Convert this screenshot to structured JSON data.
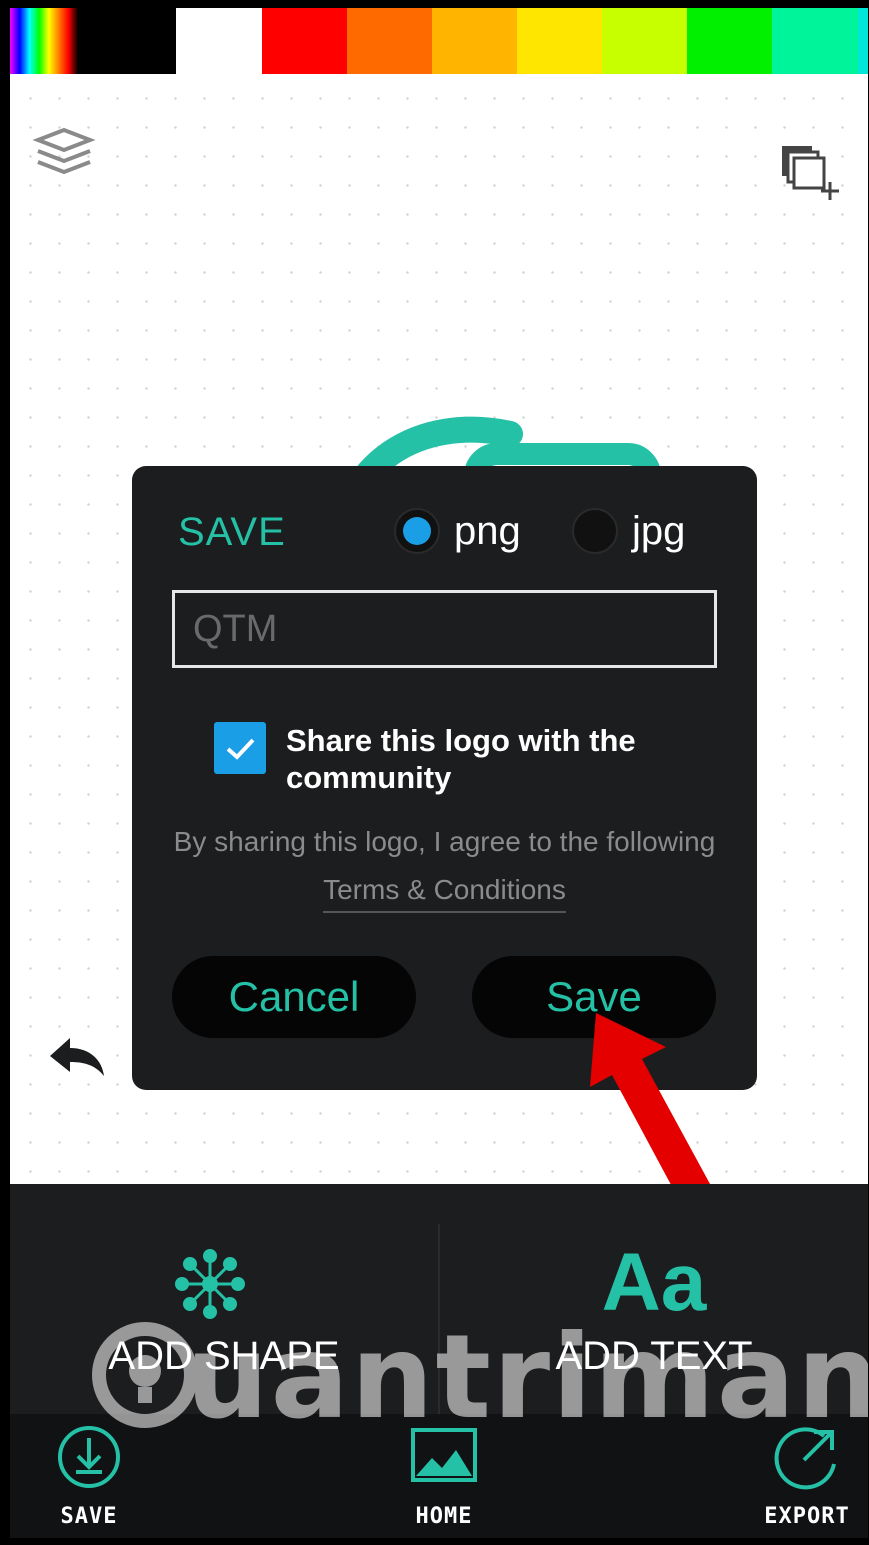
{
  "colors": {
    "accent": "#25c1a7",
    "selection_blue": "#1a9ee6",
    "dialog_bg": "#1c1d1f",
    "annotation_red": "#e50000",
    "palette": [
      "#000000",
      "#ffffff",
      "#ff0000",
      "#ff6a00",
      "#ffb400",
      "#ffe600",
      "#c8ff00",
      "#00f000",
      "#00f59a",
      "#00e6d8"
    ]
  },
  "icons": {
    "layers": "layers-icon",
    "duplicate": "duplicate-icon",
    "undo": "undo-icon",
    "radio_selected": "radio-selected-icon",
    "checkbox_checked": "checkmark-icon",
    "add_shape": "shape-flower-icon",
    "save": "download-circle-icon",
    "home": "image-icon",
    "export": "export-arrow-icon"
  },
  "dialog": {
    "title": "SAVE",
    "formats": [
      {
        "label": "png",
        "selected": true
      },
      {
        "label": "jpg",
        "selected": false
      }
    ],
    "name_placeholder": "QTM",
    "share_label": "Share this logo with the community",
    "share_checked": true,
    "terms_prefix": "By sharing this logo, I agree to the following",
    "terms_link": "Terms & Conditions",
    "cancel_label": "Cancel",
    "save_label": "Save"
  },
  "panels": {
    "add_shape_label": "ADD SHAPE",
    "add_text_icon": "Aa",
    "add_text_label": "ADD TEXT"
  },
  "watermark": "uantrimang",
  "nav": {
    "save_label": "SAVE",
    "home_label": "HOME",
    "export_label": "EXPORT"
  }
}
